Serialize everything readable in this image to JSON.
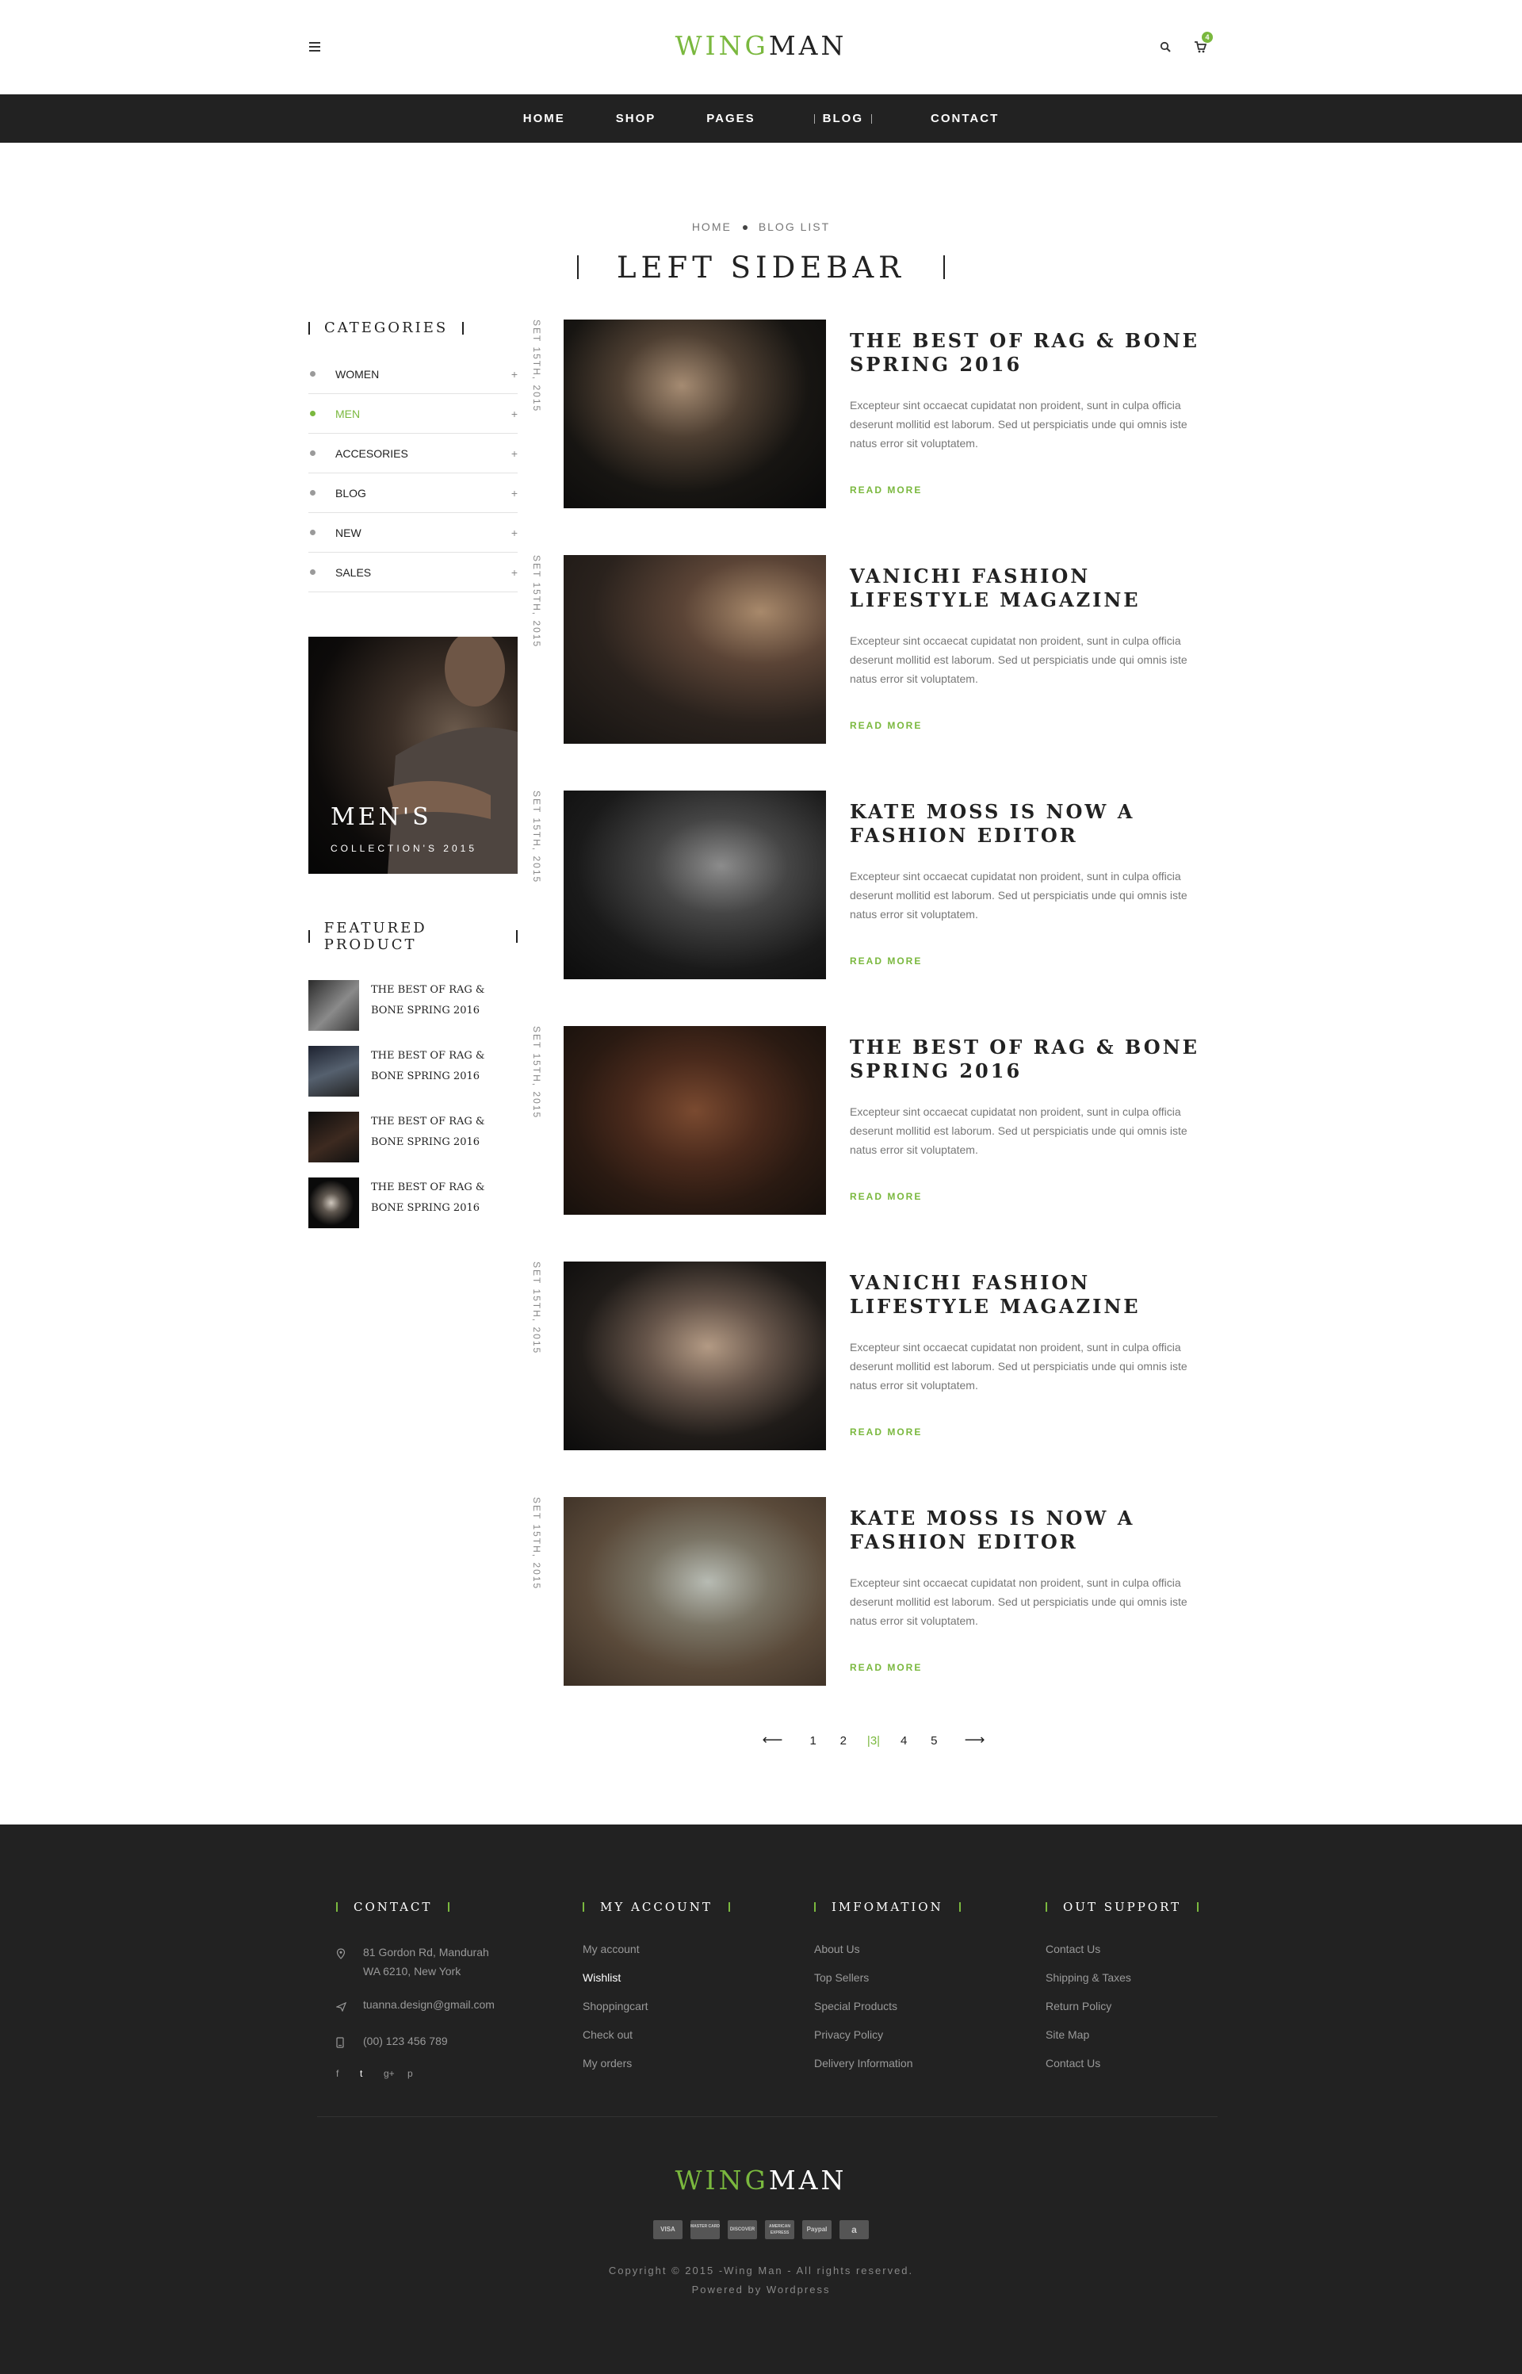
{
  "header": {
    "logo_a": "WING",
    "logo_b": "MAN",
    "cart_count": "4",
    "accent": "#7ab83e"
  },
  "nav": [
    "HOME",
    "SHOP",
    "PAGES",
    "BLOG",
    "CONTACT"
  ],
  "nav_active": "BLOG",
  "breadcrumb": {
    "home": "HOME",
    "current": "BLOG LIST"
  },
  "page_title": "LEFT SIDEBAR",
  "sidebar": {
    "categories_heading": "CATEGORIES",
    "categories": [
      {
        "label": "WOMEN",
        "active": false
      },
      {
        "label": "MEN",
        "active": true
      },
      {
        "label": "ACCESORIES",
        "active": false
      },
      {
        "label": "BLOG",
        "active": false
      },
      {
        "label": "NEW",
        "active": false
      },
      {
        "label": "SALES",
        "active": false
      }
    ],
    "banner_title": "MEN'S",
    "banner_subtitle": "COLLECTION'S 2015",
    "featured_heading": "FEATURED PRODUCT",
    "featured": [
      "THE BEST OF RAG & BONE SPRING 2016",
      "THE BEST OF RAG & BONE SPRING 2016",
      "THE BEST OF RAG & BONE SPRING 2016",
      "THE BEST OF RAG & BONE SPRING 2016"
    ]
  },
  "posts": [
    {
      "date": "SET 15TH, 2015",
      "title": "THE BEST OF RAG & BONE SPRING 2016",
      "excerpt": "Excepteur sint occaecat cupidatat non proident, sunt in culpa officia deserunt mollitid est laborum. Sed ut perspiciatis unde qui omnis iste natus error sit voluptatem.",
      "more": "READ MORE"
    },
    {
      "date": "SET 15TH, 2015",
      "title": "VANICHI FASHION LIFESTYLE MAGAZINE",
      "excerpt": "Excepteur sint occaecat cupidatat non proident, sunt in culpa officia deserunt mollitid est laborum. Sed ut perspiciatis unde qui omnis iste natus error sit voluptatem.",
      "more": "READ MORE"
    },
    {
      "date": "SET 15TH, 2015",
      "title": "KATE MOSS IS NOW A FASHION EDITOR",
      "excerpt": "Excepteur sint occaecat cupidatat non proident, sunt in culpa officia deserunt mollitid est laborum. Sed ut perspiciatis unde qui omnis iste natus error sit voluptatem.",
      "more": "READ MORE"
    },
    {
      "date": "SET 15TH, 2015",
      "title": "THE BEST OF RAG & BONE SPRING 2016",
      "excerpt": "Excepteur sint occaecat cupidatat non proident, sunt in culpa officia deserunt mollitid est laborum. Sed ut perspiciatis unde qui omnis iste natus error sit voluptatem.",
      "more": "READ MORE"
    },
    {
      "date": "SET 15TH, 2015",
      "title": "VANICHI FASHION LIFESTYLE MAGAZINE",
      "excerpt": "Excepteur sint occaecat cupidatat non proident, sunt in culpa officia deserunt mollitid est laborum. Sed ut perspiciatis unde qui omnis iste natus error sit voluptatem.",
      "more": "READ MORE"
    },
    {
      "date": "SET 15TH, 2015",
      "title": "KATE MOSS IS NOW A FASHION EDITOR",
      "excerpt": "Excepteur sint occaecat cupidatat non proident, sunt in culpa officia deserunt mollitid est laborum. Sed ut perspiciatis unde qui omnis iste natus error sit voluptatem.",
      "more": "READ MORE"
    }
  ],
  "pagination": {
    "prev": "⟵",
    "next": "⟶",
    "pages": [
      "1",
      "2",
      "3",
      "4",
      "5"
    ],
    "current": "3"
  },
  "footer": {
    "contact_heading": "CONTACT",
    "address_1": "81 Gordon Rd, Mandurah",
    "address_2": "WA 6210, New York",
    "email": "tuanna.design@gmail.com",
    "phone": "(00) 123 456 789",
    "socials": [
      "f",
      "t",
      "g+",
      "p"
    ],
    "account_heading": "MY ACCOUNT",
    "account_links": [
      "My account",
      "Wishlist",
      "Shoppingcart",
      "Check out",
      "My orders"
    ],
    "info_heading": "IMFOMATION",
    "info_links": [
      "About Us",
      "Top Sellers",
      "Special Products",
      "Privacy Policy",
      "Delivery Information"
    ],
    "support_heading": "OUT SUPPORT",
    "support_links": [
      "Contact Us",
      "Shipping & Taxes",
      "Return Policy",
      "Site Map",
      "Contact Us"
    ],
    "logo_a": "WING",
    "logo_b": "MAN",
    "payments": [
      "VISA",
      "MASTER CARD",
      "DISCOVER",
      "AMERICAN EXPRESS",
      "Paypal",
      "a"
    ],
    "copyright": "Copyright © 2015 -Wing Man - All rights reserved.",
    "powered": "Powered by Wordpress"
  }
}
